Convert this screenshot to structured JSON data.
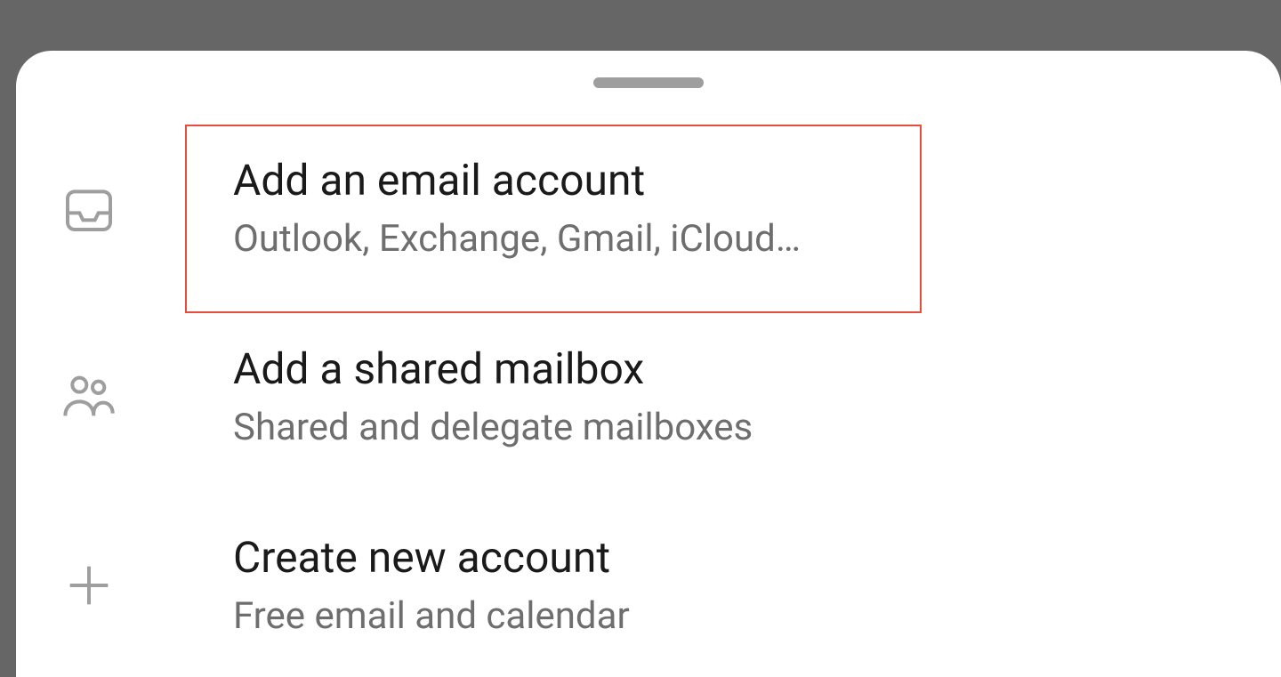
{
  "options": [
    {
      "title": "Add an email account",
      "subtitle": "Outlook, Exchange, Gmail, iCloud…",
      "icon": "inbox-icon",
      "highlighted": true
    },
    {
      "title": "Add a shared mailbox",
      "subtitle": "Shared and delegate mailboxes",
      "icon": "people-icon",
      "highlighted": false
    },
    {
      "title": "Create new account",
      "subtitle": "Free email and calendar",
      "icon": "plus-icon",
      "highlighted": false
    }
  ],
  "colors": {
    "highlight": "#e74c3c",
    "icon": "#9e9e9e",
    "title": "#1a1a1a",
    "subtitle": "#6e6e6e"
  }
}
